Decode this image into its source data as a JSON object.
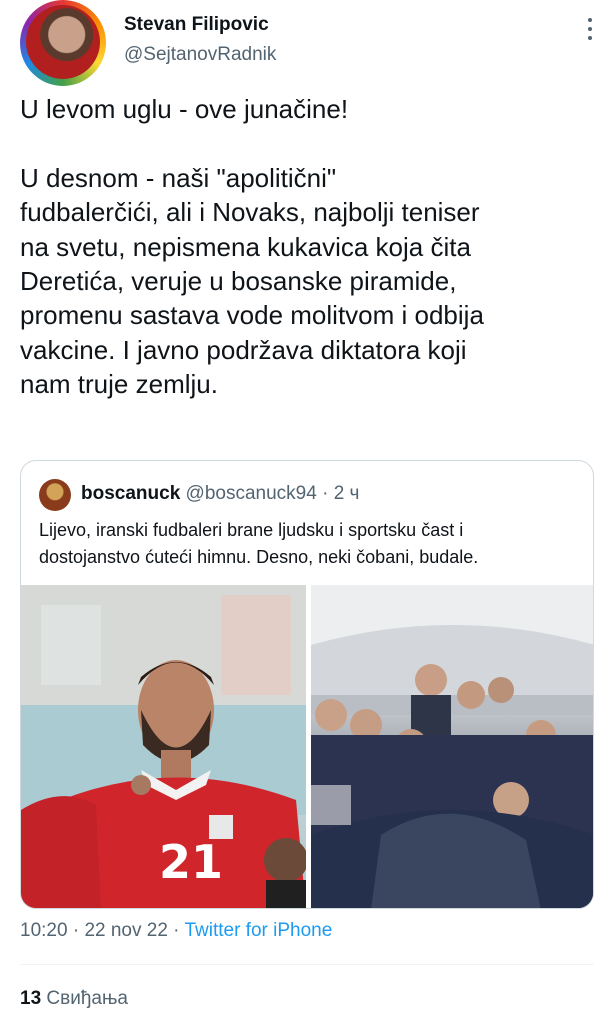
{
  "author": {
    "name": "Stevan Filipovic",
    "handle": "@SejtanovRadnik"
  },
  "tweet": {
    "lines_p1": [
      "U levom uglu - ove junačine!"
    ],
    "lines_p2": [
      "U desnom - naši \"apolitični\"",
      "fudbalerčići, ali i Novaks, najbolji teniser",
      "na svetu, nepismena kukavica koja čita",
      "Deretića, veruje u bosanske piramide,",
      "promenu sastava vode molitvom i odbija",
      "vakcine. I javno podržava diktatora koji",
      "nam truje zemlju."
    ]
  },
  "quoted": {
    "name": "boscanuck",
    "handle": "@boscanuck94",
    "sep": " · ",
    "time": "2 ч",
    "text_lines": [
      "Lijevo, iranski fudbaleri brane ljudsku i sportsku čast i",
      "dostojanstvo ćuteći himnu. Desno, neki čobani, budale."
    ],
    "jersey_number": "21"
  },
  "meta": {
    "time": "10:20",
    "sep1": " · ",
    "date": "22 nov 22",
    "sep2": " · ",
    "source": "Twitter for iPhone"
  },
  "likes": {
    "count": "13",
    "label": "Свиђања"
  },
  "colors": {
    "text": "#0f1419",
    "secondary": "#536471",
    "link": "#1d9bf0",
    "border": "#cfd9de"
  }
}
